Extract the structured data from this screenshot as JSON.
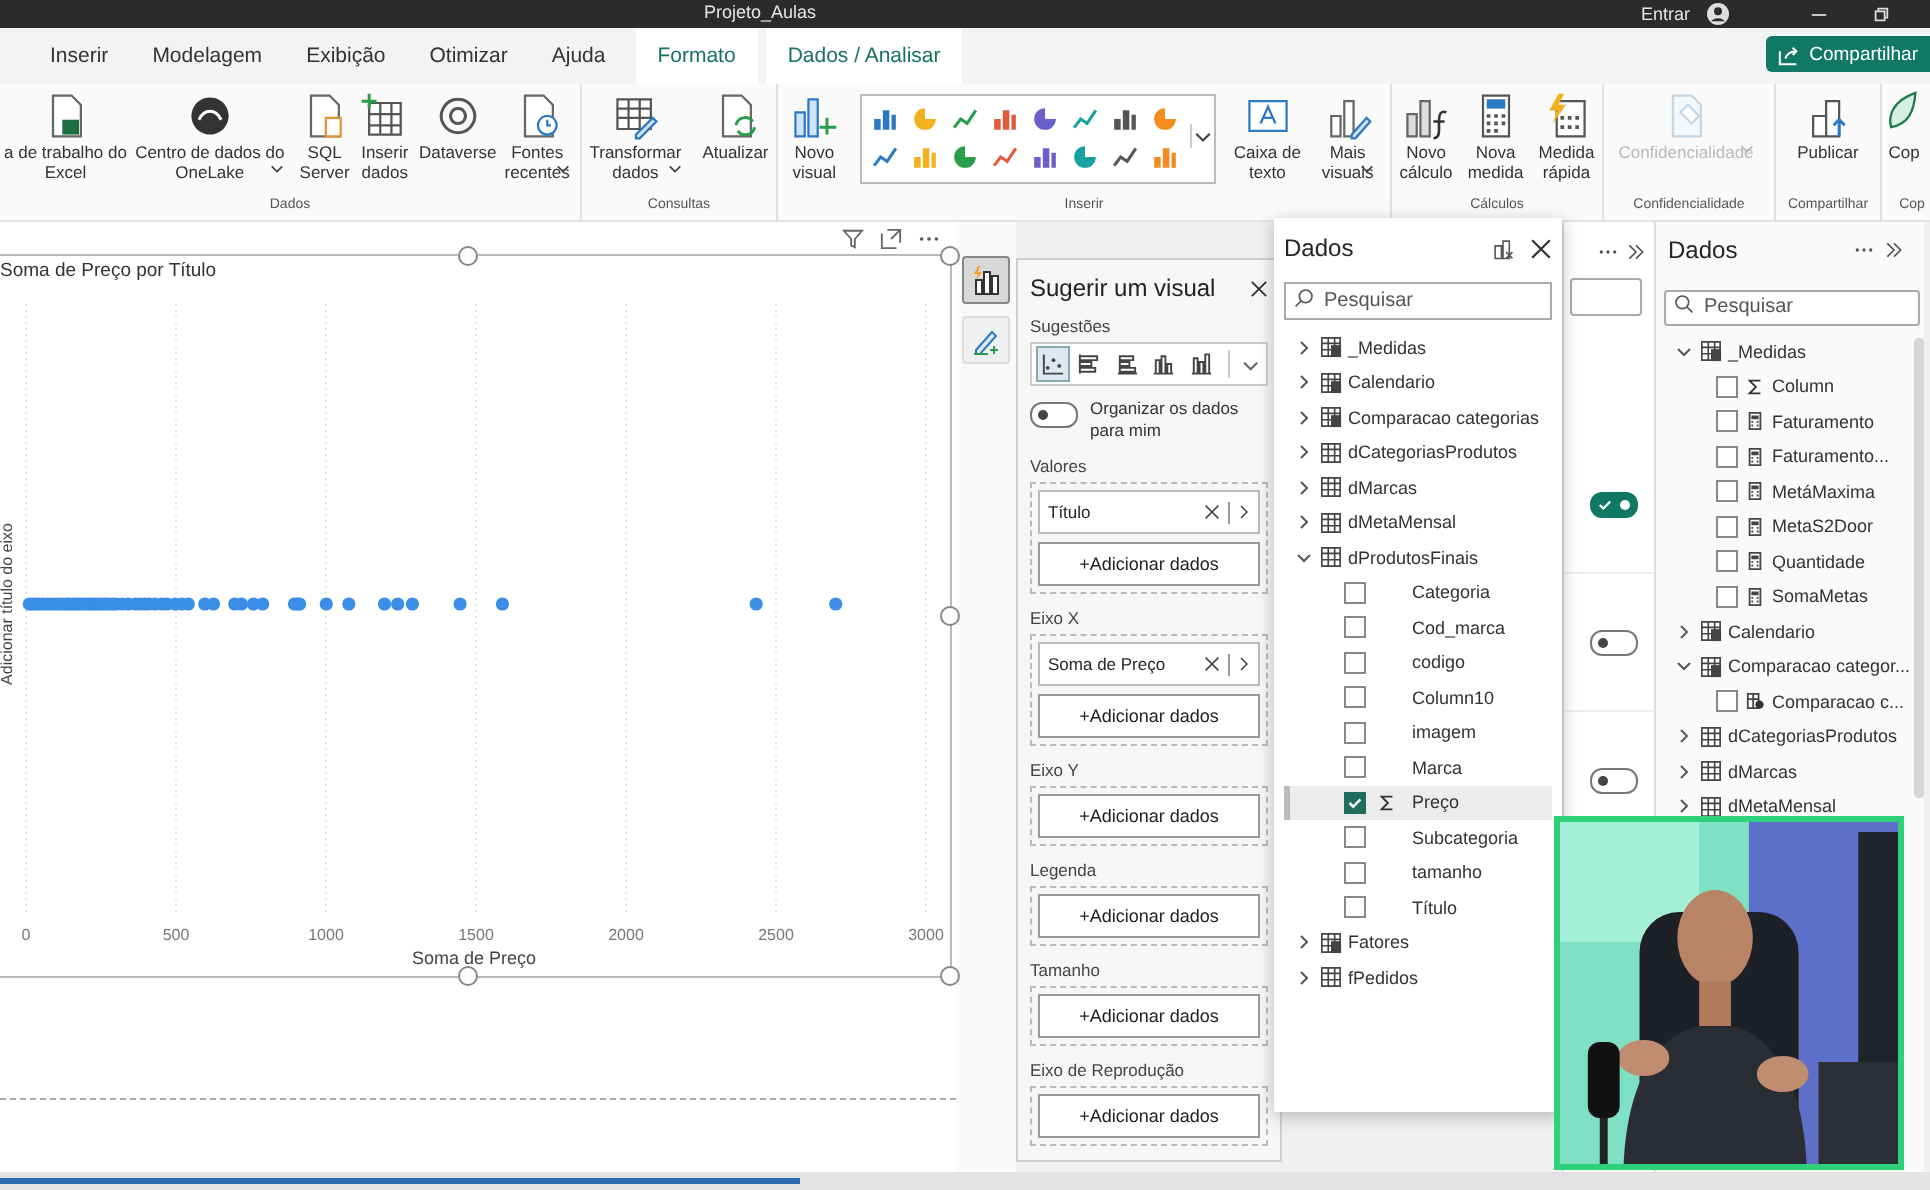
{
  "title_bar": {
    "title": "Projeto_Aulas",
    "sign_in": "Entrar"
  },
  "ribbon_tabs": [
    {
      "label": "Inserir",
      "kind": "normal"
    },
    {
      "label": "Modelagem",
      "kind": "normal"
    },
    {
      "label": "Exibição",
      "kind": "normal"
    },
    {
      "label": "Otimizar",
      "kind": "normal"
    },
    {
      "label": "Ajuda",
      "kind": "normal"
    },
    {
      "label": "Formato",
      "kind": "contextual"
    },
    {
      "label": "Dados / Analisar",
      "kind": "contextual"
    }
  ],
  "share_button": "Compartilhar",
  "ribbon_groups": [
    {
      "label": "Dados",
      "items": [
        {
          "kind": "button",
          "label": "a de trabalho do\nExcel",
          "caret": false,
          "disabled": false
        },
        {
          "kind": "button",
          "label": "Centro de dados do\nOneLake",
          "caret": true,
          "disabled": false
        },
        {
          "kind": "button",
          "label": "SQL\nServer",
          "caret": false,
          "disabled": false
        },
        {
          "kind": "button",
          "label": "Inserir\ndados",
          "caret": false,
          "disabled": false
        },
        {
          "kind": "button",
          "label": "Dataverse",
          "caret": false,
          "disabled": false
        },
        {
          "kind": "button",
          "label": "Fontes\nrecentes",
          "caret": true,
          "disabled": false
        }
      ]
    },
    {
      "label": "Consultas",
      "items": [
        {
          "kind": "button",
          "label": "Transformar\ndados",
          "caret": true,
          "disabled": false
        },
        {
          "kind": "button",
          "label": "Atualizar",
          "caret": false,
          "disabled": false
        }
      ]
    },
    {
      "label": "Inserir",
      "items": [
        {
          "kind": "button",
          "label": "Novo\nvisual",
          "caret": false,
          "disabled": false
        },
        {
          "kind": "gallery"
        },
        {
          "kind": "button",
          "label": "Caixa de\ntexto",
          "caret": false,
          "disabled": false
        },
        {
          "kind": "button",
          "label": "Mais\nvisuais",
          "caret": true,
          "disabled": false
        }
      ]
    },
    {
      "label": "Cálculos",
      "items": [
        {
          "kind": "button",
          "label": "Novo\ncálculo",
          "caret": false,
          "disabled": false
        },
        {
          "kind": "button",
          "label": "Nova\nmedida",
          "caret": false,
          "disabled": false
        },
        {
          "kind": "button",
          "label": "Medida\nrápida",
          "caret": false,
          "disabled": false
        }
      ]
    },
    {
      "label": "Confidencialidade",
      "items": [
        {
          "kind": "button",
          "label": "Confidencialidade",
          "caret": true,
          "disabled": true
        }
      ]
    },
    {
      "label": "Compartilhar",
      "items": [
        {
          "kind": "button",
          "label": "Publicar",
          "caret": false,
          "disabled": false
        }
      ]
    },
    {
      "label": "Cop",
      "items": [
        {
          "kind": "button",
          "label": "Cop",
          "caret": false,
          "disabled": false
        }
      ]
    }
  ],
  "canvas": {
    "visual": {
      "title": "Soma de Preço por Título",
      "x_axis_title": "Soma de Preço",
      "y_axis_title": "Adicionar título do eixo",
      "x_tick_labels": [
        "0",
        "500",
        "1000",
        "1500",
        "2000",
        "2500",
        "3000"
      ]
    }
  },
  "side_buttons": [
    {
      "kind": "build",
      "selected": true
    },
    {
      "kind": "format",
      "selected": false
    }
  ],
  "suggest_pane": {
    "title": "Sugerir um visual",
    "suggestions_label": "Sugestões",
    "suggestions": [
      {
        "selected": true
      },
      {
        "selected": false
      },
      {
        "selected": false
      },
      {
        "selected": false
      },
      {
        "selected": false
      }
    ],
    "organize": {
      "label": "Organizar os dados para mim",
      "on": false
    },
    "wells": [
      {
        "label": "Valores",
        "fields": [
          "Título"
        ],
        "add": "+Adicionar dados"
      },
      {
        "label": "Eixo X",
        "fields": [
          "Soma de Preço"
        ],
        "add": "+Adicionar dados"
      },
      {
        "label": "Eixo Y",
        "add": "+Adicionar dados"
      },
      {
        "label": "Legenda",
        "add": "+Adicionar dados"
      },
      {
        "label": "Tamanho",
        "add": "+Adicionar dados"
      },
      {
        "label": "Eixo de Reprodução",
        "add": "+Adicionar dados"
      }
    ]
  },
  "data_popup": {
    "title": "Dados",
    "search_placeholder": "Pesquisar",
    "tables": [
      {
        "label": "_Medidas",
        "kind": "calc-table",
        "expanded": false
      },
      {
        "label": "Calendario",
        "kind": "calc-table",
        "expanded": false
      },
      {
        "label": "Comparacao categorias",
        "kind": "calc-table",
        "expanded": false
      },
      {
        "label": "dCategoriasProdutos",
        "kind": "table",
        "expanded": false
      },
      {
        "label": "dMarcas",
        "kind": "table",
        "expanded": false
      },
      {
        "label": "dMetaMensal",
        "kind": "table",
        "expanded": false
      },
      {
        "label": "dProdutosFinais",
        "kind": "table",
        "expanded": true,
        "children": [
          {
            "label": "Categoria",
            "kind": "text",
            "checked": false,
            "selected": false
          },
          {
            "label": "Cod_marca",
            "kind": "text",
            "checked": false,
            "selected": false
          },
          {
            "label": "codigo",
            "kind": "text",
            "checked": false,
            "selected": false
          },
          {
            "label": "Column10",
            "kind": "text",
            "checked": false,
            "selected": false
          },
          {
            "label": "imagem",
            "kind": "text",
            "checked": false,
            "selected": false
          },
          {
            "label": "Marca",
            "kind": "text",
            "checked": false,
            "selected": false
          },
          {
            "label": "Preço",
            "kind": "numeric",
            "checked": true,
            "selected": true
          },
          {
            "label": "Subcategoria",
            "kind": "text",
            "checked": false,
            "selected": false
          },
          {
            "label": "tamanho",
            "kind": "text",
            "checked": false,
            "selected": false
          },
          {
            "label": "Título",
            "kind": "text",
            "checked": false,
            "selected": false
          }
        ]
      },
      {
        "label": "Fatores",
        "kind": "calc-table",
        "expanded": false
      },
      {
        "label": "fPedidos",
        "kind": "table",
        "expanded": false
      }
    ]
  },
  "format_pane": {
    "toggles": [
      {
        "on": true
      },
      {
        "on": false
      },
      {
        "on": false
      }
    ]
  },
  "data_pane": {
    "title": "Dados",
    "search_placeholder": "Pesquisar",
    "tables": [
      {
        "label": "_Medidas",
        "kind": "calc-table",
        "expanded": true,
        "children": [
          {
            "label": "Column",
            "kind": "numeric",
            "checked": false,
            "selected": false
          },
          {
            "label": "Faturamento",
            "kind": "measure",
            "checked": false,
            "selected": false
          },
          {
            "label": "Faturamento...",
            "kind": "measure",
            "checked": false,
            "selected": false
          },
          {
            "label": "MetáMaxima",
            "kind": "measure",
            "checked": false,
            "selected": false
          },
          {
            "label": "MetaS2Door",
            "kind": "measure",
            "checked": false,
            "selected": false
          },
          {
            "label": "Quantidade",
            "kind": "measure",
            "checked": false,
            "selected": false
          },
          {
            "label": "SomaMetas",
            "kind": "measure",
            "checked": false,
            "selected": false
          }
        ]
      },
      {
        "label": "Calendario",
        "kind": "calc-table",
        "expanded": false
      },
      {
        "label": "Comparacao categor...",
        "kind": "calc-table",
        "expanded": true,
        "children": [
          {
            "label": "Comparacao c...",
            "kind": "calc-column",
            "checked": false,
            "selected": false
          }
        ]
      },
      {
        "label": "dCategoriasProdutos",
        "kind": "table",
        "expanded": false
      },
      {
        "label": "dMarcas",
        "kind": "table",
        "expanded": false
      },
      {
        "label": "dMetaMensal",
        "kind": "table",
        "expanded": false
      }
    ]
  }
}
